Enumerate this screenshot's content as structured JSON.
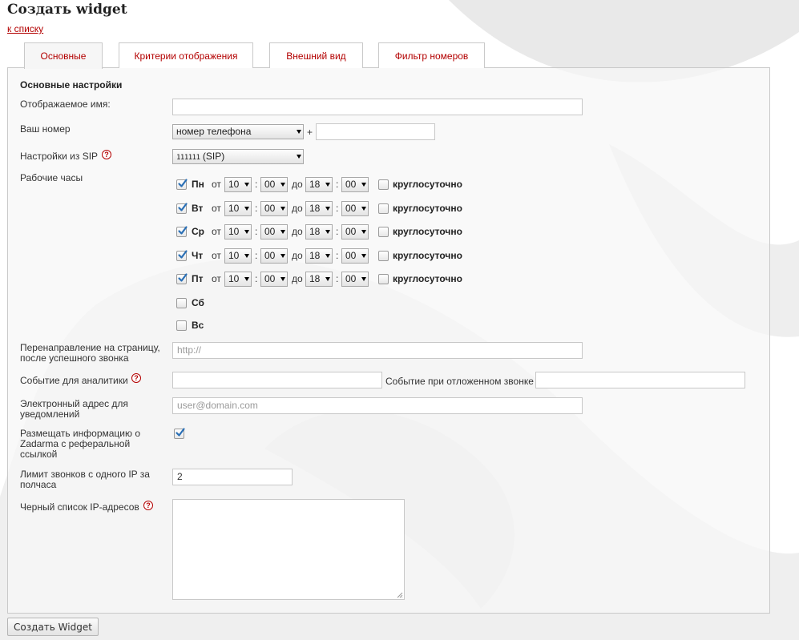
{
  "page": {
    "title": "Создать widget",
    "back_link": "к списку"
  },
  "tabs": [
    {
      "label": "Основные",
      "active": true
    },
    {
      "label": "Критерии отображения",
      "active": false
    },
    {
      "label": "Внешний вид",
      "active": false
    },
    {
      "label": "Фильтр номеров",
      "active": false
    }
  ],
  "form": {
    "section_title": "Основные настройки",
    "display_name": {
      "label": "Отображаемое имя:",
      "value": ""
    },
    "your_number": {
      "label": "Ваш номер",
      "select_value": "номер телефона",
      "plus": "+",
      "value": ""
    },
    "sip_settings": {
      "label": "Настройки из SIP",
      "select_code": "111111",
      "select_suffix": "(SIP)"
    },
    "work_hours": {
      "label": "Рабочие часы",
      "from_label": "от",
      "to_label": "до",
      "separator": ":",
      "round_the_clock_label": "круглосуточно",
      "days": [
        {
          "name": "Пн",
          "checked": true,
          "from_h": "10",
          "from_m": "00",
          "to_h": "18",
          "to_m": "00",
          "round_the_clock": false
        },
        {
          "name": "Вт",
          "checked": true,
          "from_h": "10",
          "from_m": "00",
          "to_h": "18",
          "to_m": "00",
          "round_the_clock": false
        },
        {
          "name": "Ср",
          "checked": true,
          "from_h": "10",
          "from_m": "00",
          "to_h": "18",
          "to_m": "00",
          "round_the_clock": false
        },
        {
          "name": "Чт",
          "checked": true,
          "from_h": "10",
          "from_m": "00",
          "to_h": "18",
          "to_m": "00",
          "round_the_clock": false
        },
        {
          "name": "Пт",
          "checked": true,
          "from_h": "10",
          "from_m": "00",
          "to_h": "18",
          "to_m": "00",
          "round_the_clock": false
        },
        {
          "name": "Сб",
          "checked": false
        },
        {
          "name": "Вс",
          "checked": false
        }
      ]
    },
    "redirect": {
      "label_line1": "Перенаправление на страницу,",
      "label_line2": "после успешного звонка",
      "placeholder": "http://"
    },
    "analytics": {
      "label": "Событие для аналитики",
      "value": "",
      "deferred_label": "Событие при отложенном звонке",
      "deferred_value": ""
    },
    "email": {
      "label_line1": "Электронный адрес для",
      "label_line2": "уведомлений",
      "placeholder": "user@domain.com"
    },
    "zadarma_ref": {
      "label_line1": "Размещать информацию о",
      "label_line2": "Zadarma с реферальной",
      "label_line3": "ссылкой",
      "checked": true
    },
    "ip_limit": {
      "label_line1": "Лимит звонков с одного IP за",
      "label_line2": "полчаса",
      "value": "2"
    },
    "ip_blacklist": {
      "label": "Черный список IP-адресов",
      "value": ""
    },
    "help_icon_glyph": "?"
  },
  "submit": {
    "label": "Создать Widget"
  },
  "colors": {
    "accent": "#b30000",
    "checkmark": "#2a6fb5",
    "panel_border": "#c9c9c9"
  }
}
